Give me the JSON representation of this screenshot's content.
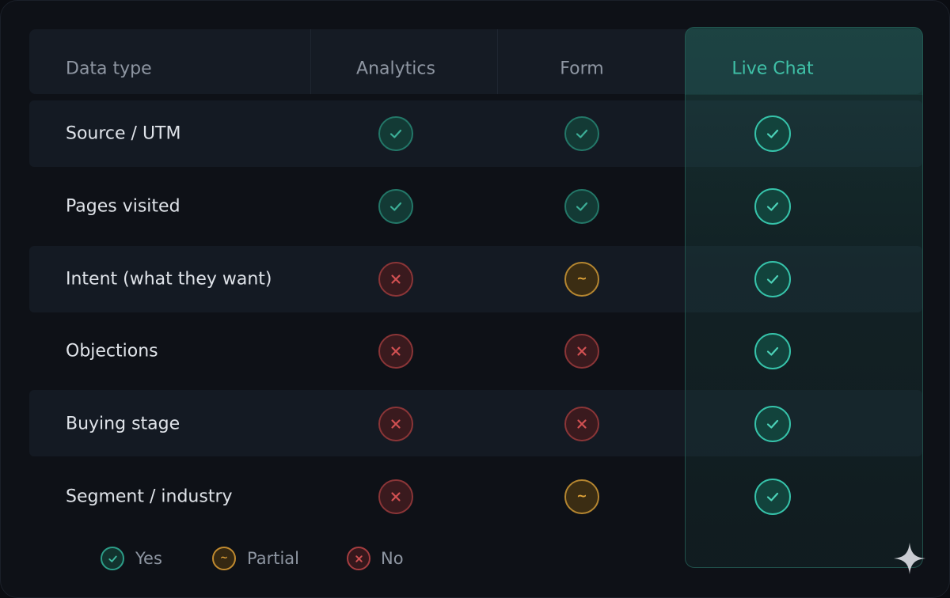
{
  "headers": {
    "data_type": "Data type",
    "analytics": "Analytics",
    "form": "Form",
    "live_chat": "Live Chat"
  },
  "rows": [
    {
      "label": "Source / UTM",
      "analytics": "yes",
      "form": "yes",
      "live_chat": "yes"
    },
    {
      "label": "Pages visited",
      "analytics": "yes",
      "form": "yes",
      "live_chat": "yes"
    },
    {
      "label": "Intent (what they want)",
      "analytics": "no",
      "form": "partial",
      "live_chat": "yes"
    },
    {
      "label": "Objections",
      "analytics": "no",
      "form": "no",
      "live_chat": "yes"
    },
    {
      "label": "Buying stage",
      "analytics": "no",
      "form": "no",
      "live_chat": "yes"
    },
    {
      "label": "Segment / industry",
      "analytics": "no",
      "form": "partial",
      "live_chat": "yes"
    }
  ],
  "legend": {
    "yes": "Yes",
    "partial": "Partial",
    "no": "No"
  },
  "partial_glyph": "~",
  "icons": {
    "yes": "check-icon",
    "partial": "tilde-icon",
    "no": "x-icon",
    "corner": "sparkle-icon"
  },
  "colors": {
    "background": "#0e1117",
    "highlight_column": "#3fc0a7",
    "yes": "#3cae97",
    "partial": "#e2a53a",
    "no": "#d25052"
  }
}
